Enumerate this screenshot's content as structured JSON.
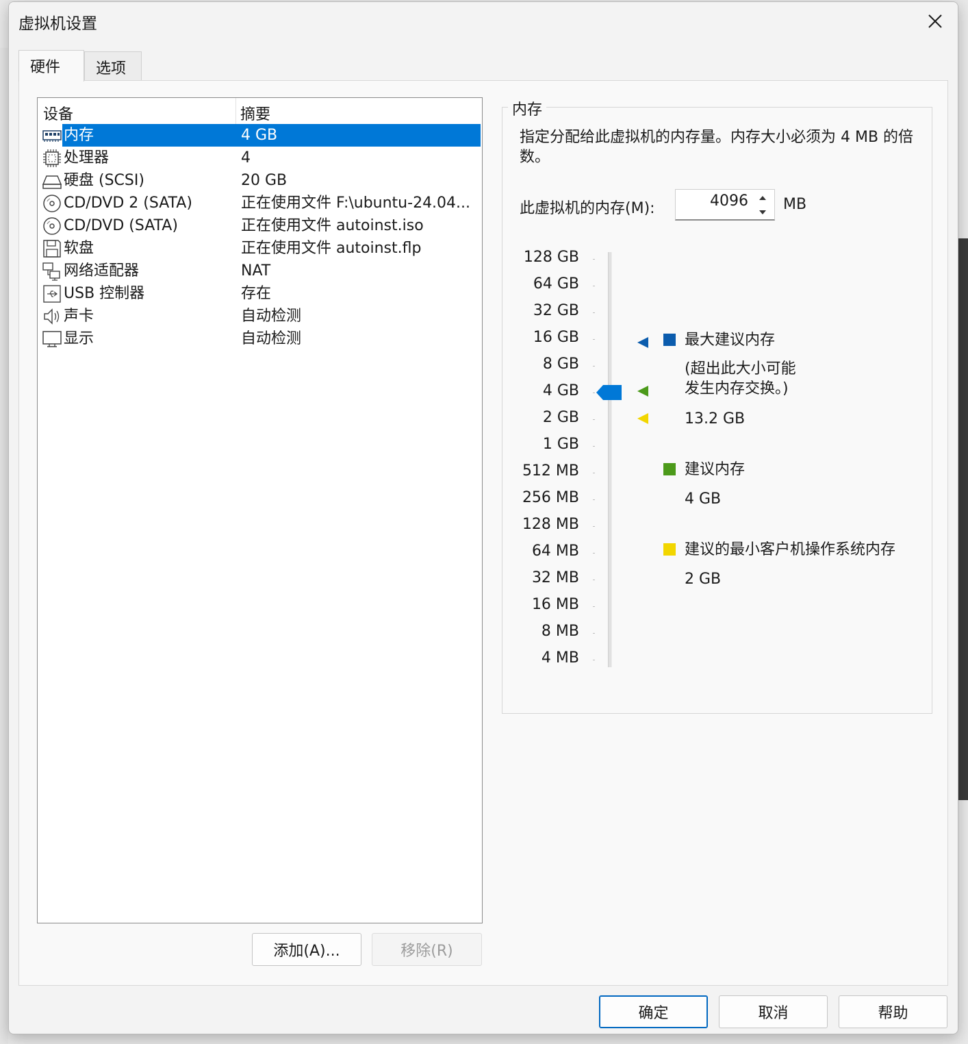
{
  "dialog": {
    "title": "虚拟机设置",
    "tabs": [
      {
        "label": "硬件",
        "active": true
      },
      {
        "label": "选项",
        "active": false
      }
    ]
  },
  "device_list": {
    "columns": [
      "设备",
      "摘要"
    ],
    "rows": [
      {
        "icon": "memory-icon",
        "name": "内存",
        "summary": "4 GB",
        "selected": true
      },
      {
        "icon": "processor-icon",
        "name": "处理器",
        "summary": "4"
      },
      {
        "icon": "hard-disk-icon",
        "name": "硬盘 (SCSI)",
        "summary": "20 GB"
      },
      {
        "icon": "cd-dvd-icon",
        "name": "CD/DVD 2 (SATA)",
        "summary": "正在使用文件 F:\\ubuntu-24.04..."
      },
      {
        "icon": "cd-dvd-icon",
        "name": "CD/DVD (SATA)",
        "summary": "正在使用文件 autoinst.iso"
      },
      {
        "icon": "floppy-icon",
        "name": "软盘",
        "summary": "正在使用文件 autoinst.flp"
      },
      {
        "icon": "network-adapter-icon",
        "name": "网络适配器",
        "summary": "NAT"
      },
      {
        "icon": "usb-controller-icon",
        "name": "USB 控制器",
        "summary": "存在"
      },
      {
        "icon": "sound-card-icon",
        "name": "声卡",
        "summary": "自动检测"
      },
      {
        "icon": "display-icon",
        "name": "显示",
        "summary": "自动检测"
      }
    ],
    "add_label": "添加(A)...",
    "remove_label": "移除(R)"
  },
  "memory_panel": {
    "group_title": "内存",
    "description": "指定分配给此虚拟机的内存量。内存大小必须为 4 MB 的倍数。",
    "input_label": "此虚拟机的内存(M):",
    "input_value": "4096",
    "unit": "MB",
    "scale": [
      "128 GB",
      "64 GB",
      "32 GB",
      "16 GB",
      "8 GB",
      "4 GB",
      "2 GB",
      "1 GB",
      "512 MB",
      "256 MB",
      "128 MB",
      "64 MB",
      "32 MB",
      "16 MB",
      "8 MB",
      "4 MB"
    ],
    "slider_value": "4 GB",
    "legend": {
      "max": {
        "label": "最大建议内存",
        "note": "(超出此大小可能 发生内存交换。)",
        "value": "13.2 GB",
        "color": "#0b5cad"
      },
      "recommended": {
        "label": "建议内存",
        "value": "4 GB",
        "color": "#4c9a1a"
      },
      "min_guest": {
        "label": "建议的最小客户机操作系统内存",
        "value": "2 GB",
        "color": "#f2d600"
      }
    }
  },
  "footer": {
    "ok_label": "确定",
    "cancel_label": "取消",
    "help_label": "帮助"
  },
  "colors": {
    "selection": "#0078d7",
    "slider_thumb": "#0078d7"
  }
}
